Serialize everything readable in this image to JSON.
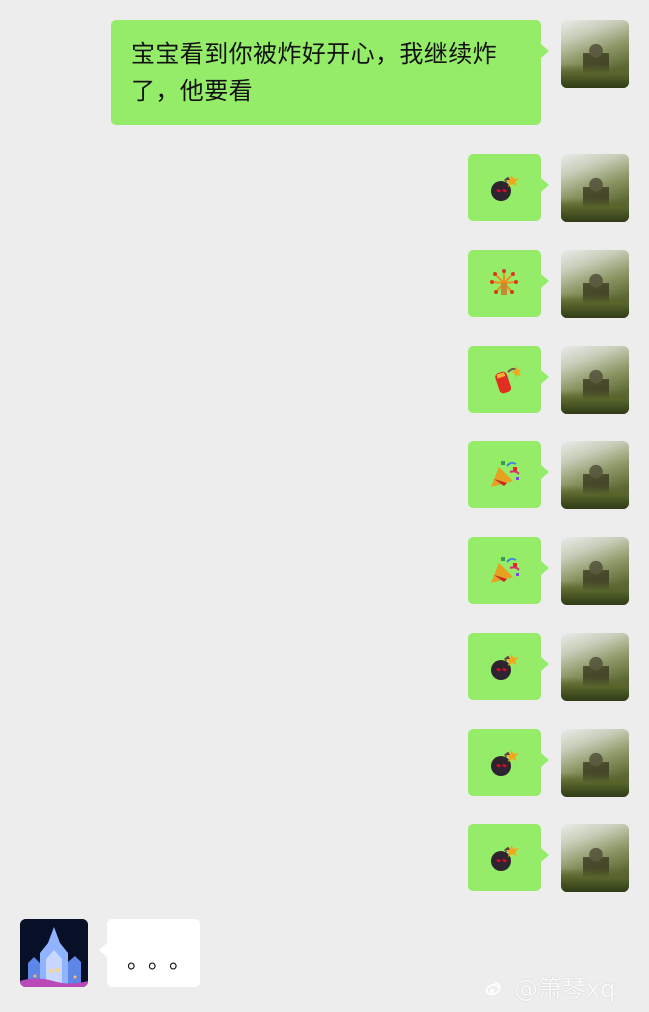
{
  "messages": {
    "first_text": "宝宝看到你被炸好开心，我继续炸了，他要看",
    "emoji_sequence": [
      "bomb-icon",
      "fireworks-icon",
      "firecracker-icon",
      "party-popper-icon",
      "party-popper-icon",
      "bomb-icon",
      "bomb-icon",
      "bomb-icon"
    ]
  },
  "reply": {
    "typing_text": "。。。"
  },
  "watermark": {
    "text": "@箫琴xq"
  },
  "colors": {
    "background": "#ededed",
    "sent_bubble": "#95ec69",
    "received_bubble": "#ffffff"
  }
}
